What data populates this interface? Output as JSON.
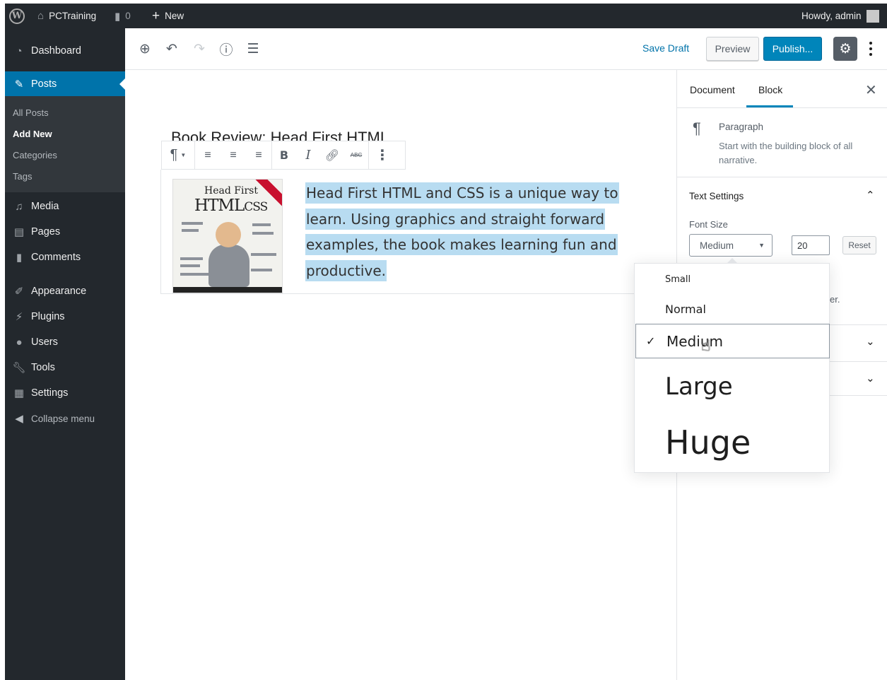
{
  "adminbar": {
    "site_name": "PCTraining",
    "comments_count": "0",
    "new_label": "New",
    "howdy": "Howdy, admin"
  },
  "sidebar": {
    "dashboard": "Dashboard",
    "posts": "Posts",
    "submenu": [
      "All Posts",
      "Add New",
      "Categories",
      "Tags"
    ],
    "items": [
      "Media",
      "Pages",
      "Comments",
      "Appearance",
      "Plugins",
      "Users",
      "Tools",
      "Settings"
    ],
    "collapse": "Collapse menu"
  },
  "header": {
    "save_draft": "Save Draft",
    "preview": "Preview",
    "publish": "Publish..."
  },
  "post": {
    "title": "Book Review: Head First HTML",
    "book_title_line1": "Head First",
    "book_title_line2": "HTML",
    "book_title_line3": "CSS",
    "paragraph_lines": [
      "Head First HTML and CSS is a unique way to",
      "learn. Using graphics and straight forward",
      "examples, the book makes learning fun and",
      "productive."
    ]
  },
  "settings_panel": {
    "tabs": [
      "Document",
      "Block"
    ],
    "active_tab": "Block",
    "block_name": "Paragraph",
    "block_desc": "Start with the building block of all narrative.",
    "text_settings": "Text Settings",
    "font_size_label": "Font Size",
    "font_size_selected": "Medium",
    "font_size_value": "20",
    "reset": "Reset",
    "hidden_fragment": "er."
  },
  "font_size_options": [
    "Small",
    "Normal",
    "Medium",
    "Large",
    "Huge"
  ],
  "colors": {
    "admin_dark": "#23282d",
    "accent_blue": "#0073aa",
    "publish_blue": "#0085ba",
    "highlight": "#b8dcf1"
  }
}
